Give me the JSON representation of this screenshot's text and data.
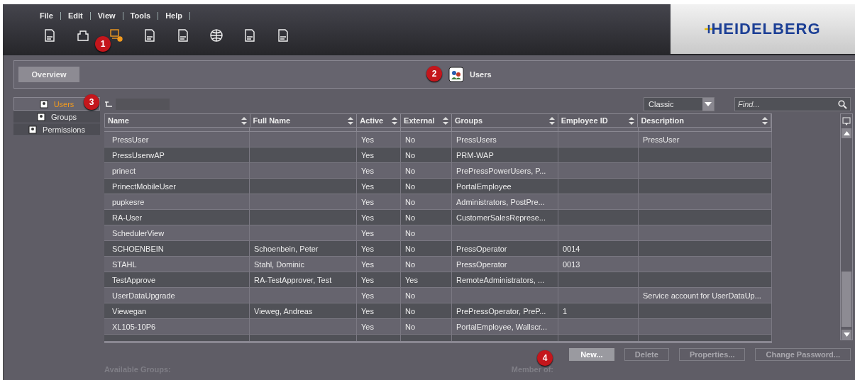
{
  "menu": [
    "File",
    "Edit",
    "View",
    "Tools",
    "Help"
  ],
  "toolbar": [
    {
      "kind": "doc",
      "selected": false
    },
    {
      "kind": "press",
      "selected": false
    },
    {
      "kind": "users",
      "selected": true
    },
    {
      "kind": "machine",
      "selected": false
    },
    {
      "kind": "import",
      "selected": false
    },
    {
      "kind": "globe",
      "selected": false
    },
    {
      "kind": "chart",
      "selected": false
    },
    {
      "kind": "flow",
      "selected": false
    }
  ],
  "logo": "HEIDELBERG",
  "overview_button": "Overview",
  "page_title": "Users",
  "sidebar": [
    {
      "label": "Users",
      "selected": true
    },
    {
      "label": "Groups",
      "selected": false
    },
    {
      "label": "Permissions",
      "selected": false
    }
  ],
  "view_select": {
    "value": "Classic"
  },
  "search": {
    "placeholder": "Find..."
  },
  "table": {
    "columns": [
      "Name",
      "Full Name",
      "Active",
      "External",
      "Groups",
      "Employee ID",
      "Description"
    ],
    "rows": [
      [
        "PressUser",
        "",
        "Yes",
        "No",
        "PressUsers",
        "",
        "PressUser"
      ],
      [
        "PressUserwAP",
        "",
        "Yes",
        "No",
        "PRM-WAP",
        "",
        ""
      ],
      [
        "prinect",
        "",
        "Yes",
        "No",
        "PrePressPowerUsers, P...",
        "",
        ""
      ],
      [
        "PrinectMobileUser",
        "",
        "Yes",
        "No",
        "PortalEmployee",
        "",
        ""
      ],
      [
        "pupkesre",
        "",
        "Yes",
        "No",
        "Administrators, PostPre...",
        "",
        ""
      ],
      [
        "RA-User",
        "",
        "Yes",
        "No",
        "CustomerSalesReprese...",
        "",
        ""
      ],
      [
        "SchedulerView",
        "",
        "Yes",
        "No",
        "",
        "",
        ""
      ],
      [
        "SCHOENBEIN",
        "Schoenbein, Peter",
        "Yes",
        "No",
        "PressOperator",
        "0014",
        ""
      ],
      [
        "STAHL",
        "Stahl, Dominic",
        "Yes",
        "No",
        "PressOperator",
        "0013",
        ""
      ],
      [
        "TestApprove",
        "RA-TestApprover, Test",
        "Yes",
        "Yes",
        "RemoteAdministrators, ...",
        "",
        ""
      ],
      [
        "UserDataUpgrade",
        "",
        "Yes",
        "No",
        "",
        "",
        "Service account for UserDataUp..."
      ],
      [
        "Viewegan",
        "Vieweg, Andreas",
        "Yes",
        "No",
        "PrePressOperator, PreP...",
        "1",
        ""
      ],
      [
        "XL105-10P6",
        "",
        "Yes",
        "No",
        "PortalEmployee, Wallscr...",
        "",
        ""
      ]
    ]
  },
  "buttons": [
    {
      "label": "New...",
      "disabled": false
    },
    {
      "label": "Delete",
      "disabled": true
    },
    {
      "label": "Properties...",
      "disabled": true
    },
    {
      "label": "Change Password...",
      "disabled": true
    }
  ],
  "labels": [
    "Available Groups:",
    "Member of:"
  ],
  "callouts": [
    "1",
    "2",
    "3",
    "4"
  ]
}
